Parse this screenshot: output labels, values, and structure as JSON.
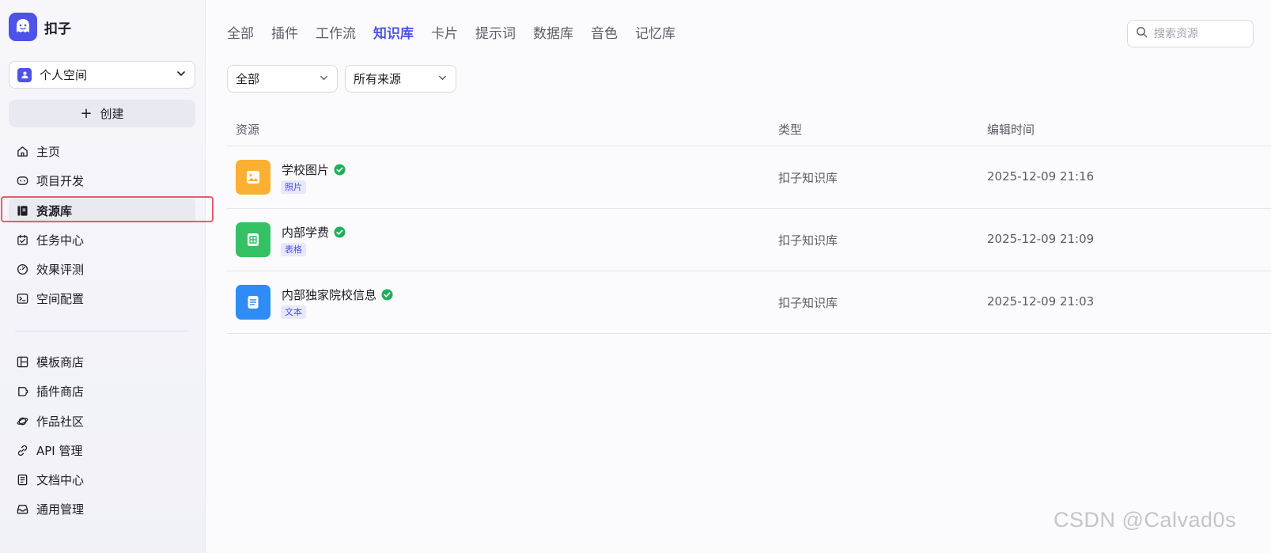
{
  "brand": {
    "name": "扣子",
    "color": "#4d53e8"
  },
  "space": {
    "label": "个人空间"
  },
  "create": {
    "label": "创建"
  },
  "nav_primary": [
    {
      "label": "主页",
      "icon": "home-icon"
    },
    {
      "label": "项目开发",
      "icon": "robot-icon"
    },
    {
      "label": "资源库",
      "icon": "library-icon",
      "active": true
    },
    {
      "label": "任务中心",
      "icon": "task-icon"
    },
    {
      "label": "效果评测",
      "icon": "gauge-icon"
    },
    {
      "label": "空间配置",
      "icon": "terminal-icon"
    }
  ],
  "nav_secondary": [
    {
      "label": "模板商店",
      "icon": "template-icon"
    },
    {
      "label": "插件商店",
      "icon": "plugin-icon"
    },
    {
      "label": "作品社区",
      "icon": "planet-icon"
    },
    {
      "label": "API 管理",
      "icon": "link-icon"
    },
    {
      "label": "文档中心",
      "icon": "document-icon"
    },
    {
      "label": "通用管理",
      "icon": "inbox-icon"
    }
  ],
  "tabs": [
    "全部",
    "插件",
    "工作流",
    "知识库",
    "卡片",
    "提示词",
    "数据库",
    "音色",
    "记忆库"
  ],
  "active_tab": "知识库",
  "search": {
    "placeholder": "搜索资源"
  },
  "filters": {
    "type": "全部",
    "source": "所有来源"
  },
  "table": {
    "headers": {
      "resource": "资源",
      "type": "类型",
      "edited": "编辑时间"
    },
    "rows": [
      {
        "name": "学校图片",
        "tag": "照片",
        "type": "扣子知识库",
        "edited": "2025-12-09 21:16",
        "icon": "image-icon",
        "color": "#fbb034"
      },
      {
        "name": "内部学费",
        "tag": "表格",
        "type": "扣子知识库",
        "edited": "2025-12-09 21:09",
        "icon": "table-icon",
        "color": "#34c063"
      },
      {
        "name": "内部独家院校信息",
        "tag": "文本",
        "type": "扣子知识库",
        "edited": "2025-12-09 21:03",
        "icon": "text-doc-icon",
        "color": "#2f8cf7"
      }
    ]
  },
  "watermark": "CSDN @Calvad0s"
}
